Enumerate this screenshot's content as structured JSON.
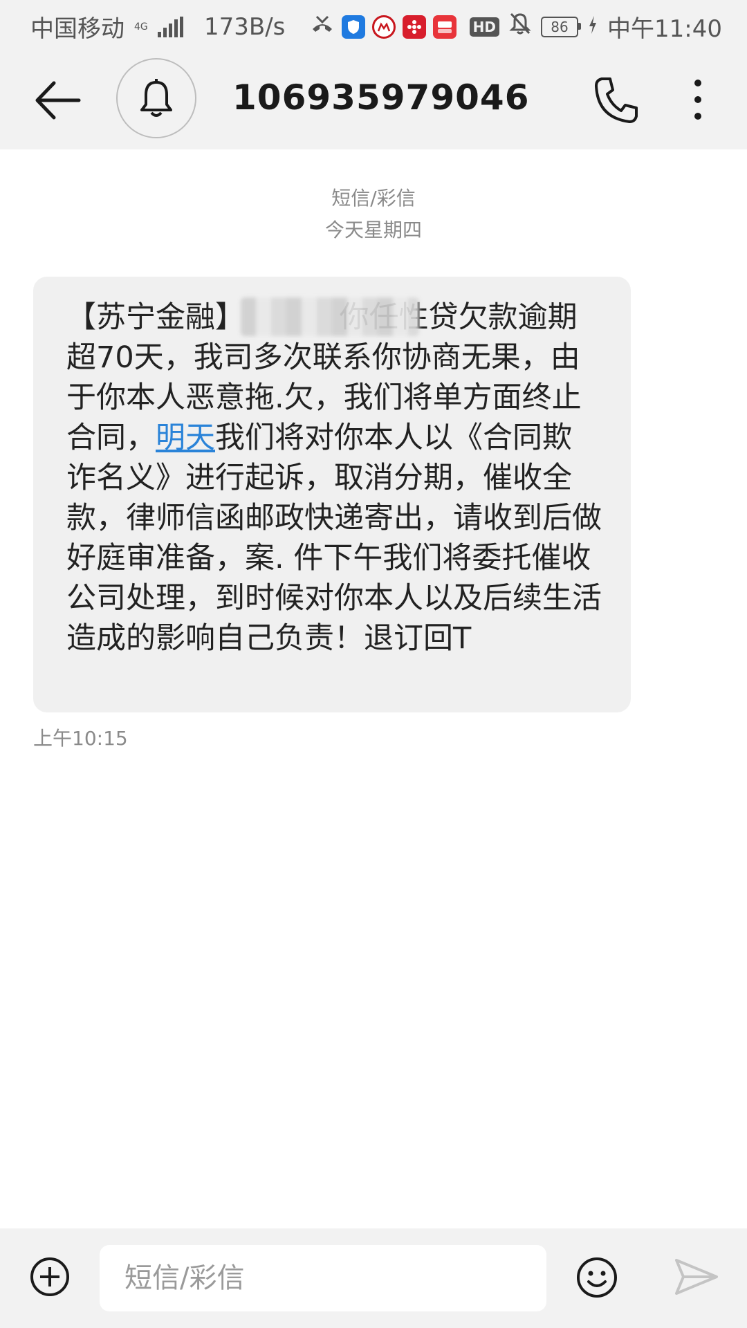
{
  "status_bar": {
    "carrier": "中国移动",
    "network": "4G",
    "net_speed": "173B/s",
    "more_dots": "···",
    "hd_label": "HD",
    "battery_level": "86",
    "time": "中午11:40",
    "app_icons": [
      "missed-call-icon",
      "shield-app-icon",
      "bank-app-icon",
      "flower-app-icon",
      "pay-app-icon"
    ]
  },
  "header": {
    "contact_number": "106935979046"
  },
  "meta": {
    "channel_label": "短信/彩信",
    "day_label": "今天星期四"
  },
  "message": {
    "text_before_link": "【苏宁金融】          你任性贷欠款逾期超70天，我司多次联系你协商无果，由于你本人恶意拖.欠，我们将单方面终止合同，",
    "link_text": "明天",
    "text_after_link": "我们将对你本人以《合同欺 诈名义》进行起诉，取消分期，催收全款，律师信函邮政快递寄出，请收到后做好庭审准备，案. 件下午我们将委托催收公司处理，到时候对你本人以及后续生活造成的影响自己负责！退订回T",
    "time": "上午10:15"
  },
  "composer": {
    "placeholder": "短信/彩信"
  },
  "colors": {
    "bar_bg": "#f2f2f2",
    "bubble_bg": "#f0f0f0",
    "link": "#2a83d8",
    "meta_text": "#8a8a8a"
  }
}
